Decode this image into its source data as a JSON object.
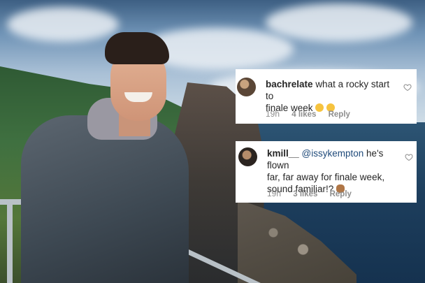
{
  "comments": [
    {
      "username": "bachrelate",
      "mention": "",
      "text_line1": "what a rocky start to",
      "text_line2": "finale week",
      "emojis": [
        "grimacing-face-emoji",
        "flushed-face-emoji"
      ],
      "time": "19h",
      "likes": "4 likes",
      "reply": "Reply"
    },
    {
      "username": "kmill__",
      "mention": "@issykempton",
      "text_line1": "he's flown",
      "text_line2": "far, far away for finale week,",
      "text_line3": "sound familiar!?",
      "emojis": [
        "see-no-evil-monkey-emoji"
      ],
      "time": "19h",
      "likes": "3 likes",
      "reply": "Reply"
    }
  ],
  "icons": {
    "like": "heart-icon",
    "avatar": "profile-avatar"
  }
}
